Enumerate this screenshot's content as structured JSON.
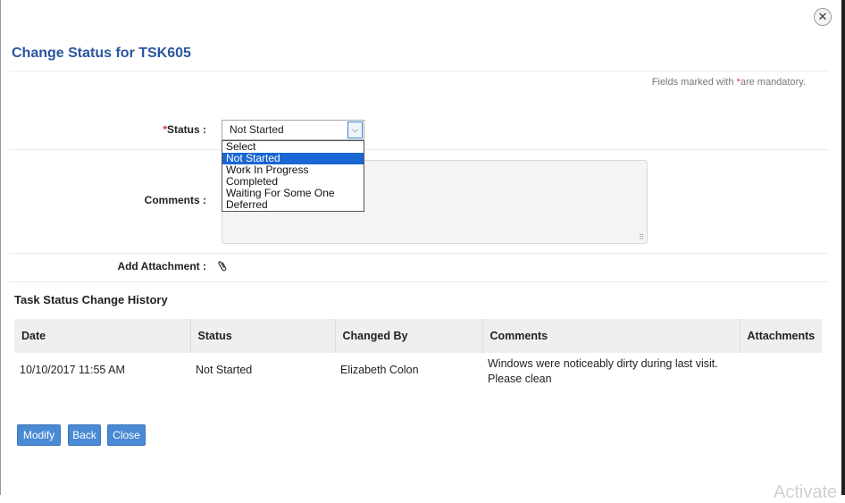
{
  "dialog": {
    "title": "Change Status for TSK605",
    "close_icon": "close-icon"
  },
  "form": {
    "mandatory_note": {
      "prefix": "Fields marked with ",
      "star": "*",
      "suffix": "are mandatory."
    },
    "status": {
      "star": "*",
      "label": "Status :",
      "selected": "Not Started",
      "options": [
        "Select",
        "Not Started",
        "Work In Progress",
        "Completed",
        "Waiting For Some One",
        "Deferred"
      ]
    },
    "comments": {
      "label": "Comments :",
      "value": ""
    },
    "attachment": {
      "label": "Add Attachment :",
      "icon": "paperclip-icon"
    }
  },
  "history": {
    "title": "Task Status Change History",
    "columns": [
      "Date",
      "Status",
      "Changed By",
      "Comments",
      "Attachments"
    ],
    "rows": [
      {
        "date": "10/10/2017 11:55 AM",
        "status": "Not Started",
        "changed_by": "Elizabeth Colon",
        "comments_line1": "Windows were noticeably dirty during last visit.",
        "comments_line2": "Please clean",
        "attachments": ""
      }
    ]
  },
  "buttons": {
    "modify": "Modify",
    "back": "Back",
    "close": "Close"
  },
  "watermark": "Activate",
  "colors": {
    "title": "#2a56a0",
    "button": "#4a8ad4",
    "selected_option": "#1a66d2",
    "required_star": "#d23a3a"
  }
}
